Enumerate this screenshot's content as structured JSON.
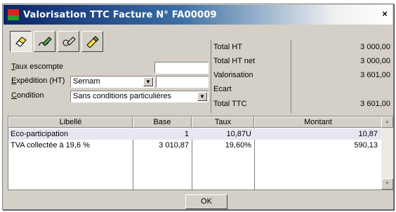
{
  "window": {
    "title": "Valorisation TTC Facture N° FA00009",
    "close": "×"
  },
  "toolbar": {
    "icons": [
      "eraser-icon",
      "pen-edit-icon",
      "pen-check-icon",
      "pen-pencil-icon"
    ]
  },
  "form": {
    "taux_escompte": {
      "label": "Taux escompte",
      "value": ""
    },
    "expedition": {
      "label": "Expédition (HT)",
      "select_value": "Sernam",
      "amount": ""
    },
    "condition": {
      "label": "Condition",
      "select_value": "Sans conditions particulières"
    }
  },
  "totals": [
    {
      "label": "Total HT",
      "value": "3 000,00"
    },
    {
      "label": "Total HT net",
      "value": "3 000,00"
    },
    {
      "label": "Valorisation",
      "value": "3 601,00"
    },
    {
      "label": "Ecart",
      "value": ""
    },
    {
      "label": "Total TTC",
      "value": "3 601,00"
    }
  ],
  "table": {
    "columns": [
      "Libellé",
      "Base",
      "Taux",
      "Montant"
    ],
    "rows": [
      {
        "libelle": "Eco-participation",
        "base": "1",
        "taux": "10,87U",
        "montant": "10,87"
      },
      {
        "libelle": "TVA collectée à 19,6 %",
        "base": "3 010,87",
        "taux": "19,60%",
        "montant": "590,13"
      }
    ]
  },
  "buttons": {
    "ok": "OK"
  }
}
